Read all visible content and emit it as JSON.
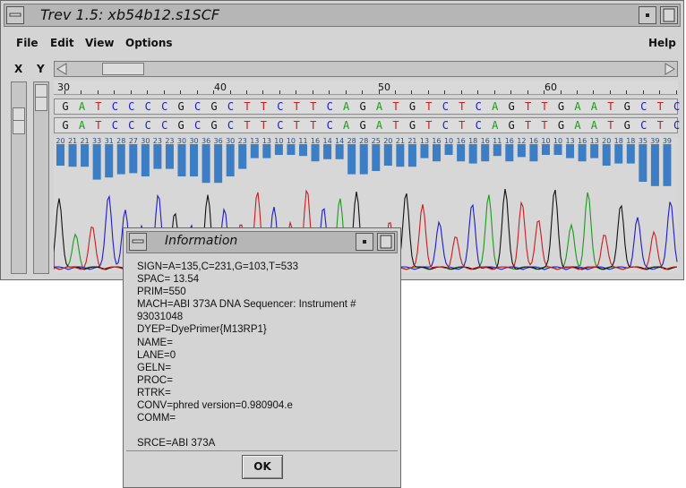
{
  "window": {
    "title": "Trev 1.5: xb54b12.s1SCF"
  },
  "menubar": {
    "file": "File",
    "edit": "Edit",
    "view": "View",
    "options": "Options",
    "help": "Help"
  },
  "axes": {
    "x_label": "X",
    "y_label": "Y"
  },
  "ruler": {
    "numbers": [
      "30",
      "40",
      "50",
      "60"
    ]
  },
  "sequence": {
    "called_bases": [
      "G",
      "A",
      "T",
      "C",
      "C",
      "C",
      "C",
      "G",
      "C",
      "G",
      "C",
      "T",
      "T",
      "C",
      "T",
      "T",
      "C",
      "A",
      "G",
      "A",
      "T",
      "G",
      "T",
      "C",
      "T",
      "C",
      "A",
      "G",
      "T",
      "T",
      "G",
      "A",
      "A",
      "T",
      "G",
      "C",
      "T",
      "C"
    ],
    "edited_bases": [
      "G",
      "A",
      "T",
      "C",
      "C",
      "C",
      "C",
      "G",
      "C",
      "G",
      "C",
      "T",
      "T",
      "C",
      "T",
      "T",
      "C",
      "A",
      "G",
      "A",
      "T",
      "G",
      "T",
      "C",
      "T",
      "C",
      "A",
      "G",
      "T",
      "T",
      "G",
      "A",
      "A",
      "T",
      "G",
      "C",
      "T",
      "C"
    ],
    "base_colors": {
      "A": "#1a9a1a",
      "C": "#1c1ccc",
      "G": "#111111",
      "T": "#cc1c1c"
    }
  },
  "quality": {
    "values": [
      20,
      21,
      21,
      33,
      31,
      28,
      27,
      30,
      23,
      23,
      30,
      30,
      36,
      36,
      30,
      23,
      13,
      13,
      10,
      10,
      11,
      16,
      14,
      14,
      28,
      28,
      25,
      20,
      21,
      21,
      13,
      16,
      10,
      16,
      18,
      16,
      11,
      16,
      12,
      16,
      10,
      10,
      13,
      16,
      13,
      20,
      18,
      18,
      35,
      39,
      39
    ],
    "labels": [
      "20",
      "21",
      "21",
      "33",
      "31",
      "28",
      "27",
      "30",
      "23",
      "23",
      "30",
      "30",
      "36",
      "36",
      "30",
      "23",
      "13",
      "13",
      "10",
      "10",
      "11",
      "16",
      "14",
      "14",
      "28",
      "28",
      "25",
      "20",
      "21",
      "21",
      "13",
      "16",
      "10",
      "16",
      "18",
      "16",
      "11",
      "16",
      "12",
      "16",
      "10",
      "10",
      "13",
      "16",
      "13",
      "20",
      "18",
      "18",
      "35",
      "39",
      "39"
    ],
    "bar_color": "#3c7dc4"
  },
  "info_dialog": {
    "title": "Information",
    "lines": [
      "SIGN=A=135,C=231,G=103,T=533",
      "SPAC= 13.54",
      "PRIM=550",
      "MACH=ABI 373A DNA Sequencer: Instrument #",
      "93031048",
      "DYEP=DyePrimer{M13RP1}",
      "NAME=",
      "LANE=0",
      "GELN=",
      "PROC=",
      "RTRK=",
      "CONV=phred version=0.980904.e",
      "COMM=",
      "",
      "SRCE=ABI 373A"
    ],
    "ok_label": "OK"
  }
}
